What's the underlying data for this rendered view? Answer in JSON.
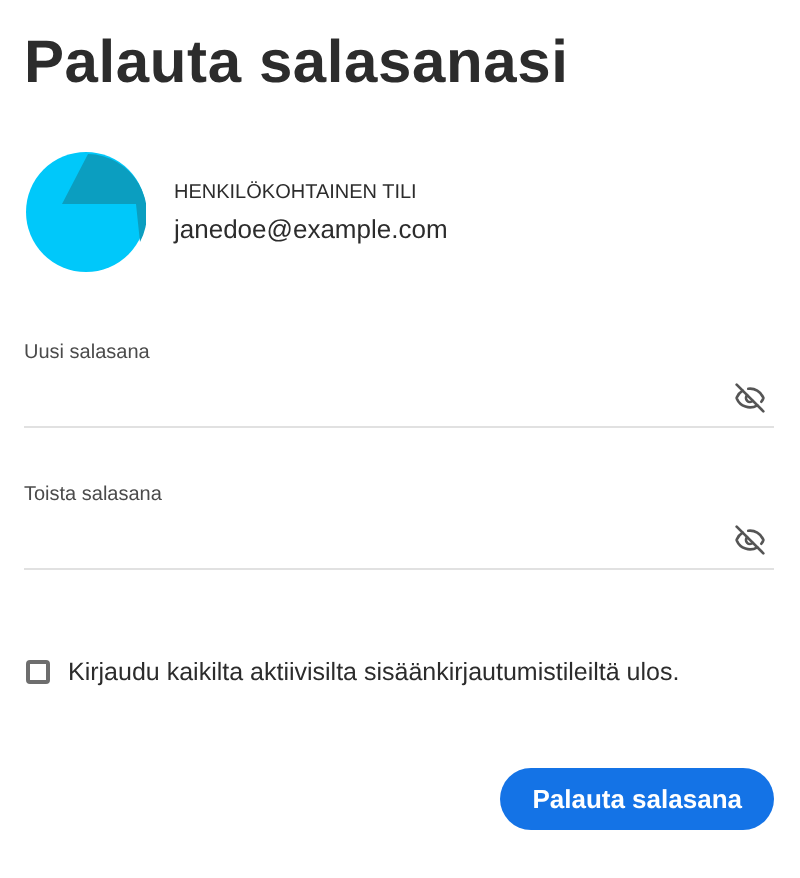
{
  "title": "Palauta salasanasi",
  "account": {
    "type": "HENKILÖKOHTAINEN TILI",
    "email": "janedoe@example.com"
  },
  "fields": [
    {
      "label": "Uusi salasana",
      "password_visible": false
    },
    {
      "label": "Toista salasana",
      "password_visible": false
    }
  ],
  "signout_all": {
    "label": "Kirjaudu kaikilta aktiivisilta sisäänkirjautumistileiltä ulos.",
    "checked": false
  },
  "submit": {
    "label": "Palauta salasana"
  }
}
